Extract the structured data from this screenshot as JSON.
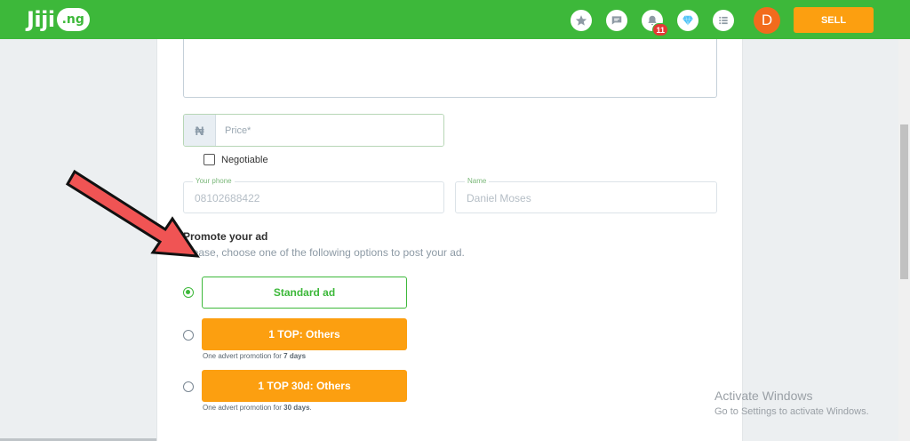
{
  "header": {
    "logo_text": "Jiji",
    "logo_suffix": ".ng",
    "notification_count": "11",
    "avatar_initial": "D",
    "sell_label": "SELL",
    "icons": [
      "star-icon",
      "chat-icon",
      "bell-icon",
      "diamond-icon",
      "list-icon"
    ]
  },
  "form": {
    "currency_symbol": "₦",
    "price_placeholder": "Price*",
    "negotiable_label": "Negotiable",
    "negotiable_checked": false,
    "phone_label": "Your phone",
    "phone_value": "08102688422",
    "name_label": "Name",
    "name_value": "Daniel Moses"
  },
  "promote": {
    "title": "Promote your ad",
    "subtitle": "Please, choose one of the following options to post your ad.",
    "selected_option": 0,
    "options": [
      {
        "label": "Standard ad"
      },
      {
        "label": "1 TOP: Others",
        "note_prefix": "One advert promotion for",
        "note_days": "7 days"
      },
      {
        "label": "1 TOP 30d: Others",
        "note_prefix": "One advert promotion for",
        "note_days": "30 days",
        "note_suffix": "."
      }
    ]
  },
  "watermark": {
    "title": "Activate Windows",
    "subtitle": "Go to Settings to activate Windows."
  },
  "colors": {
    "brand_green": "#3db83a",
    "orange": "#fc9f10",
    "arrow_red": "#f05454"
  }
}
